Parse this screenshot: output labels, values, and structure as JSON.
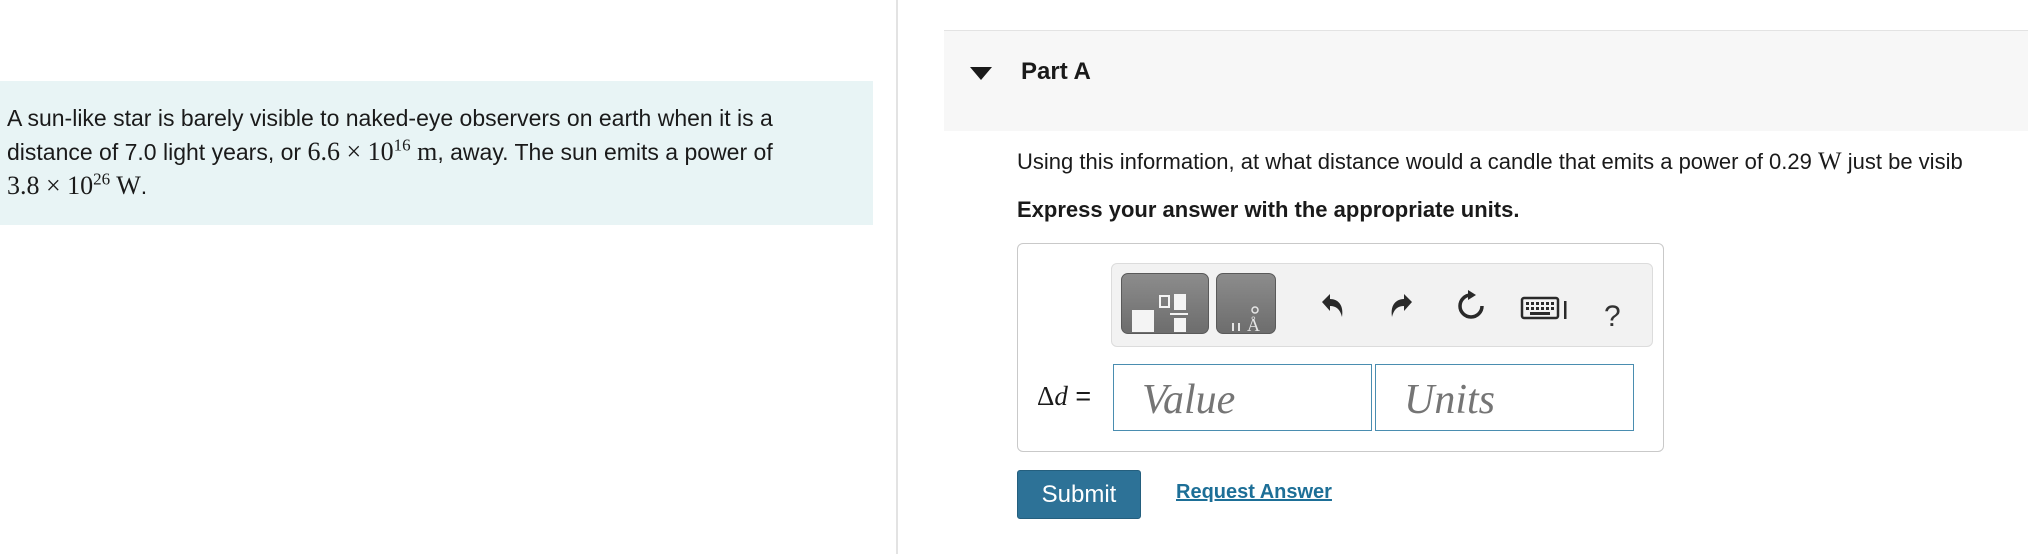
{
  "problem": {
    "text_1": "A sun-like star is barely visible to naked-eye observers on earth when it is a",
    "text_2": "distance of 7.0 light years, or ",
    "distance_mantissa": "6.6",
    "times": "×",
    "ten": "10",
    "distance_exp": "16",
    "distance_unit": "m",
    "text_3": ", away. The sun emits a power of",
    "power_mantissa": "3.8",
    "power_exp": "26",
    "power_unit": "W",
    "period": "."
  },
  "part": {
    "title": "Part A"
  },
  "question": {
    "text_1": "Using this information, at what distance would a candle that emits a power of 0.29",
    "unit": "W",
    "text_2": "just be visib"
  },
  "instruction": "Express your answer with the appropriate units.",
  "answer": {
    "label_delta": "Δ",
    "label_var": "d",
    "label_eq": " =",
    "value_placeholder": "Value",
    "units_placeholder": "Units"
  },
  "toolbar": {
    "units_glyph": "Å",
    "help": "?"
  },
  "buttons": {
    "submit": "Submit",
    "request_answer": "Request Answer"
  },
  "colors": {
    "problem_bg": "#e8f4f5",
    "submit_bg": "#2d7297",
    "link": "#1d6f97",
    "field_border": "#4a8db0"
  },
  "icons": [
    "templates-icon",
    "units-icon",
    "undo-icon",
    "redo-icon",
    "reset-icon",
    "keyboard-icon",
    "help-icon",
    "caret-down-icon"
  ]
}
